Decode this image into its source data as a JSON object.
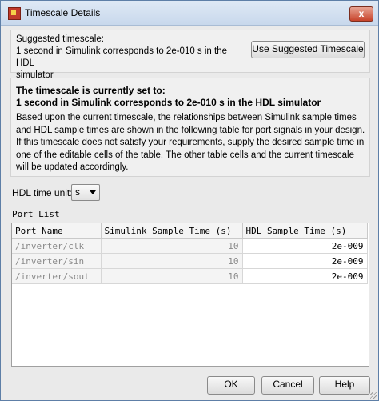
{
  "window": {
    "title": "Timescale Details",
    "close_label": "x"
  },
  "suggested": {
    "line1": "Suggested timescale:",
    "line2": "1 second in Simulink corresponds to 2e-010 s in the HDL",
    "line3": "simulator",
    "button_label": "Use Suggested Timescale"
  },
  "current": {
    "heading": "The timescale is currently set to:",
    "value": "1 second in Simulink corresponds to 2e-010 s in the HDL simulator",
    "description": "Based upon the current timescale, the relationships between Simulink sample times and HDL sample times are shown in the following table for port signals in your design. If this timescale does not satisfy your requirements, supply the desired sample time in one of the editable cells of the table. The other table cells and the current timescale will be updated accordingly."
  },
  "hdl_unit": {
    "label": "HDL time unit:",
    "selected": "s"
  },
  "port_list": {
    "label": "Port List",
    "columns": [
      "Port Name",
      "Simulink Sample Time (s)",
      "HDL Sample Time (s)"
    ],
    "rows": [
      [
        "/inverter/clk",
        "10",
        "2e-009"
      ],
      [
        "/inverter/sin",
        "10",
        "2e-009"
      ],
      [
        "/inverter/sout",
        "10",
        "2e-009"
      ]
    ]
  },
  "buttons": {
    "ok": "OK",
    "cancel": "Cancel",
    "help": "Help"
  },
  "colors": {
    "title_gradient_top": "#dfe9f5",
    "close_button": "#c7432a",
    "panel_bg": "#f0f0f0",
    "readonly_text": "#8a8a8a"
  }
}
